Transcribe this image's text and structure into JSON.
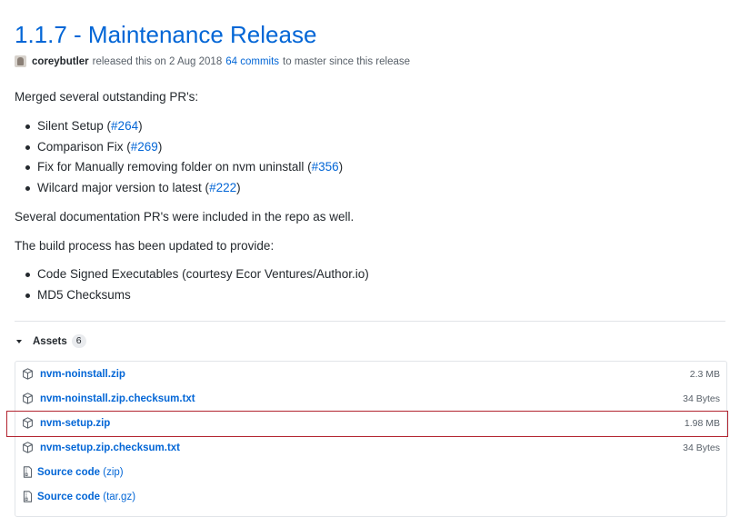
{
  "release": {
    "title": "1.1.7 - Maintenance Release",
    "author": "coreybutler",
    "released_text": "released this on 2 Aug 2018",
    "commits_link": "64 commits",
    "commits_suffix": "to master since this release"
  },
  "body": {
    "intro": "Merged several outstanding PR's:",
    "prs": [
      {
        "text": "Silent Setup (",
        "link": "#264",
        "after": ")"
      },
      {
        "text": "Comparison Fix (",
        "link": "#269",
        "after": ")"
      },
      {
        "text": "Fix for Manually removing folder on nvm uninstall (",
        "link": "#356",
        "after": ")"
      },
      {
        "text": "Wilcard major version to latest (",
        "link": "#222",
        "after": ")"
      }
    ],
    "docs_note": "Several documentation PR's were included in the repo as well.",
    "build_intro": "The build process has been updated to provide:",
    "build_items": [
      "Code Signed Executables (courtesy Ecor Ventures/Author.io)",
      "MD5 Checksums"
    ]
  },
  "assets": {
    "label": "Assets",
    "count": "6",
    "files": [
      {
        "name": "nvm-noinstall.zip",
        "size": "2.3 MB"
      },
      {
        "name": "nvm-noinstall.zip.checksum.txt",
        "size": "34 Bytes"
      },
      {
        "name": "nvm-setup.zip",
        "size": "1.98 MB"
      },
      {
        "name": "nvm-setup.zip.checksum.txt",
        "size": "34 Bytes"
      }
    ],
    "sources": [
      {
        "name": "Source code",
        "format": "(zip)"
      },
      {
        "name": "Source code",
        "format": "(tar.gz)"
      }
    ]
  },
  "colors": {
    "link": "#0366d6",
    "text": "#24292e",
    "muted": "#586069",
    "highlight_border": "#b2232f"
  }
}
